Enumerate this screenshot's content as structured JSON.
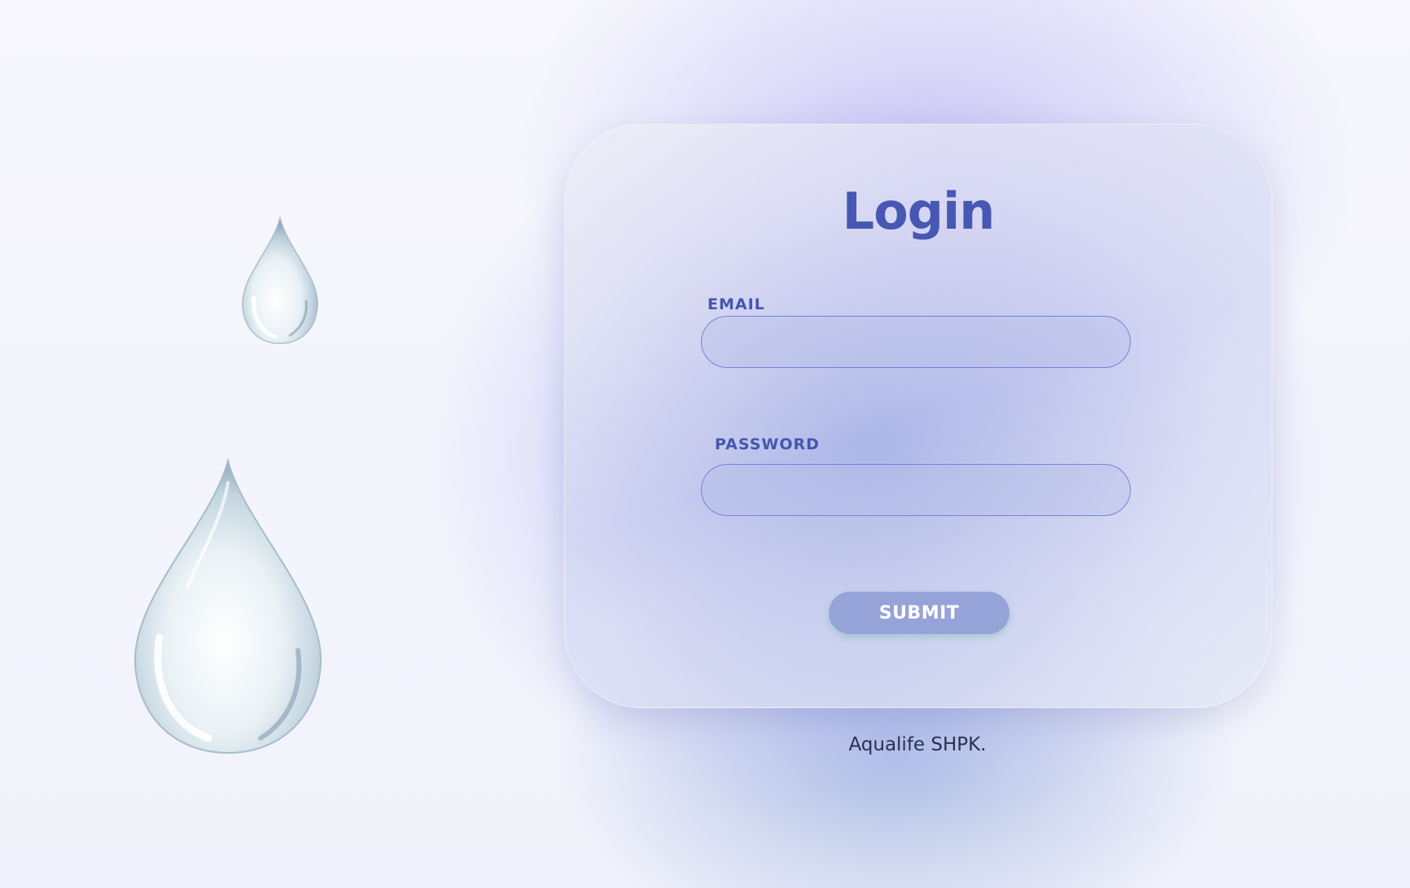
{
  "login": {
    "title": "Login",
    "email_label": "EMAIL",
    "email_value": "",
    "password_label": "PASSWORD",
    "password_value": "",
    "submit_label": "SUBMIT"
  },
  "footer": {
    "company": "Aqualife SHPK."
  },
  "decor": {
    "icons": [
      "water-drop-icon",
      "water-drop-icon"
    ]
  },
  "colors": {
    "accent": "#4758b3",
    "button": "#96a3d9",
    "button_text": "#ffffff",
    "footer_text": "#2a3050"
  }
}
